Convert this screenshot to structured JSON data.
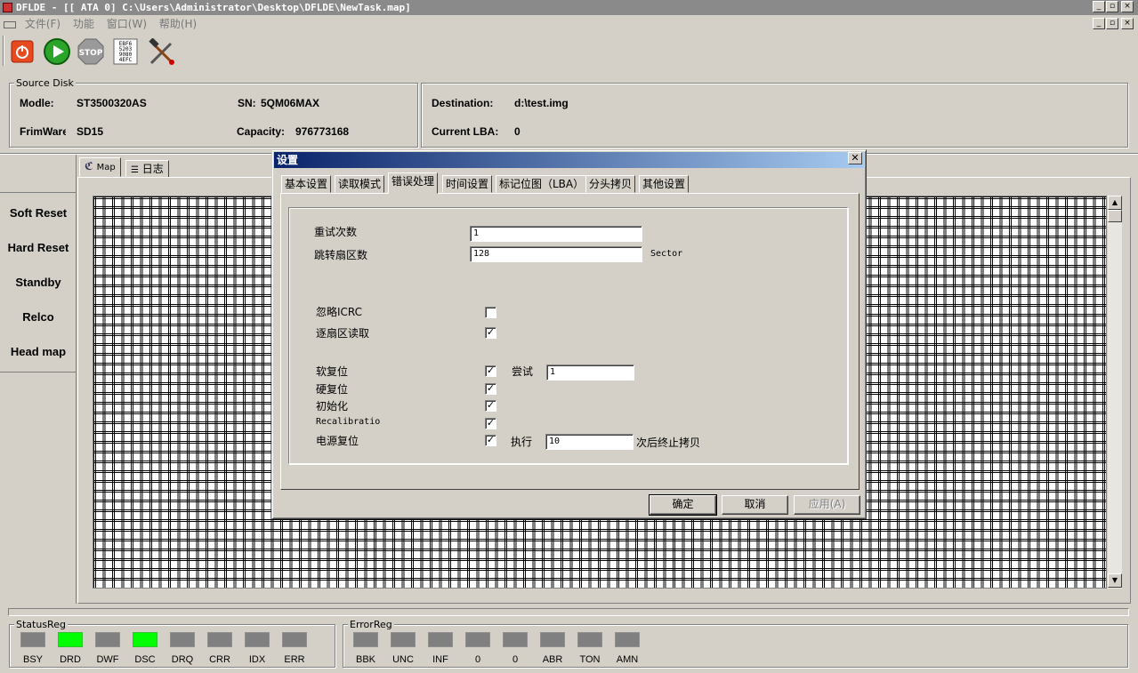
{
  "window": {
    "title": "DFLDE - [[ ATA 0]  C:\\Users\\Administrator\\Desktop\\DFLDE\\NewTask.map]"
  },
  "menu": {
    "items": [
      "文件(F)",
      "功能",
      "窗口(W)",
      "帮助(H)"
    ]
  },
  "toolbar": {
    "icons": [
      "power-icon",
      "play-icon",
      "stop-icon",
      "hex-data-icon",
      "tools-icon"
    ],
    "stop_label": "STOP",
    "hex_label": "EBF6 5203 9080 4EFC"
  },
  "source": {
    "title": "Source Disk",
    "model_label": "Modle:",
    "model_value": "ST3500320AS",
    "sn_label": "SN:",
    "sn_value": "5QM06MAX",
    "firmware_label": "FrimWare",
    "firmware_value": "SD15",
    "capacity_label": "Capacity:",
    "capacity_value": "976773168"
  },
  "destination": {
    "dest_label": "Destination:",
    "dest_value": "d:\\test.img",
    "lba_label": "Current LBA:",
    "lba_value": "0"
  },
  "left_buttons": [
    "Soft Reset",
    "Hard Reset",
    "Standby",
    "Relco",
    "Head map"
  ],
  "main_tabs": [
    "Map",
    "日志"
  ],
  "dialog": {
    "title": "设置",
    "tabs": [
      "基本设置",
      "读取模式",
      "错误处理",
      "时间设置",
      "标记位图（LBA）",
      "分头拷贝",
      "其他设置"
    ],
    "active_tab": "错误处理",
    "retry_label": "重试次数",
    "retry_value": "1",
    "skip_label": "跳转扇区数",
    "skip_value": "128",
    "skip_unit": "Sector",
    "ignore_icrc_label": "忽略ICRC",
    "ignore_icrc_checked": false,
    "sector_read_label": "逐扇区读取",
    "sector_read_checked": true,
    "soft_reset_label": "软复位",
    "soft_reset_checked": true,
    "try_label": "尝试",
    "try_value": "1",
    "hard_reset_label": "硬复位",
    "hard_reset_checked": true,
    "init_label": "初始化",
    "init_checked": true,
    "recal_label": "Recalibratio",
    "recal_checked": true,
    "power_reset_label": "电源复位",
    "power_reset_checked": true,
    "exec_label": "执行",
    "exec_value": "10",
    "exec_suffix": "次后终止拷贝",
    "ok_label": "确定",
    "cancel_label": "取消",
    "apply_label": "应用(A)"
  },
  "status_reg": {
    "title": "StatusReg",
    "leds": [
      {
        "label": "BSY",
        "on": false
      },
      {
        "label": "DRD",
        "on": true
      },
      {
        "label": "DWF",
        "on": false
      },
      {
        "label": "DSC",
        "on": true
      },
      {
        "label": "DRQ",
        "on": false
      },
      {
        "label": "CRR",
        "on": false
      },
      {
        "label": "IDX",
        "on": false
      },
      {
        "label": "ERR",
        "on": false
      }
    ]
  },
  "error_reg": {
    "title": "ErrorReg",
    "leds": [
      {
        "label": "BBK",
        "on": false
      },
      {
        "label": "UNC",
        "on": false
      },
      {
        "label": "INF",
        "on": false
      },
      {
        "label": "0",
        "on": false
      },
      {
        "label": "0",
        "on": false
      },
      {
        "label": "ABR",
        "on": false
      },
      {
        "label": "TON",
        "on": false
      },
      {
        "label": "AMN",
        "on": false
      }
    ]
  }
}
